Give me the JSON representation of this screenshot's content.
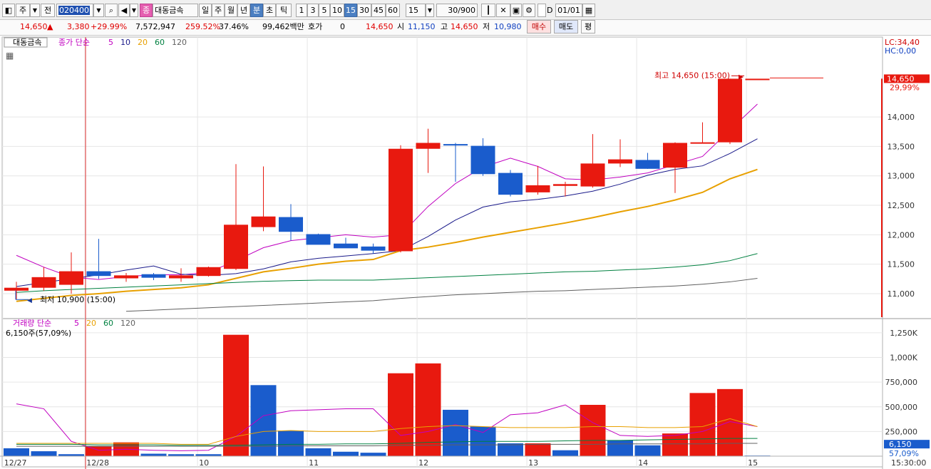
{
  "toolbar": {
    "period_mode": "주",
    "prev_label": "전",
    "code": "020400",
    "stock_name": "대동금속",
    "stock_badge": "종",
    "period_tabs": [
      {
        "label": "일",
        "selected": false
      },
      {
        "label": "주",
        "selected": false
      },
      {
        "label": "월",
        "selected": false
      },
      {
        "label": "년",
        "selected": false
      },
      {
        "label": "분",
        "selected": true
      },
      {
        "label": "초",
        "selected": false
      },
      {
        "label": "틱",
        "selected": false
      }
    ],
    "minute_tabs": [
      {
        "label": "1",
        "selected": false
      },
      {
        "label": "3",
        "selected": false
      },
      {
        "label": "5",
        "selected": false
      },
      {
        "label": "10",
        "selected": false
      },
      {
        "label": "15",
        "selected": true
      },
      {
        "label": "30",
        "selected": false
      },
      {
        "label": "45",
        "selected": false
      },
      {
        "label": "60",
        "selected": false
      }
    ],
    "interval_value": "15",
    "count_value": "30",
    "count_max": "/900",
    "d_label": "D",
    "date_value": "01/01"
  },
  "quote": {
    "price": "14,650",
    "change": "3,380",
    "change_pct": "+29.99%",
    "volume": "7,572,947",
    "vol_ratio": "259.52%",
    "turnover": "37.46%",
    "amount": "99,462백만",
    "hoga_label": "호가",
    "hoga_value": "0",
    "hoga_price": "14,650",
    "open_label": "시",
    "open_value": "11,150",
    "high_label": "고",
    "high_value": "14,650",
    "low_label": "저",
    "low_value": "10,980",
    "buy_label": "매수",
    "sell_label": "매도",
    "eval_label": "평"
  },
  "chart_data": {
    "type": "candlestick",
    "stock_label": "대동금속",
    "price_legend": {
      "prefix": "종가 단순",
      "ma_periods": [
        "5",
        "10",
        "20",
        "60",
        "120"
      ],
      "ma_colors": [
        "#c000c0",
        "#1a1a8a",
        "#e8a000",
        "#008040",
        "#606060"
      ]
    },
    "lc_label": "LC:34,40",
    "hc_label": "HC:0,00",
    "price_axis": {
      "min": 10600,
      "max": 15200,
      "ticks": [
        "14,000",
        "13,500",
        "13,000",
        "12,500",
        "12,000",
        "11,500",
        "11,000"
      ],
      "tick_values": [
        14000,
        13500,
        13000,
        12500,
        12000,
        11500,
        11000
      ]
    },
    "current_price_badge": "14,650",
    "current_pct_badge": "29,99%",
    "high_annotation": "최고 14,650 (15:00)",
    "low_annotation": "최저 10,900 (15:00)",
    "candles": [
      {
        "o": 11050,
        "h": 11200,
        "l": 10900,
        "c": 11100
      },
      {
        "o": 11100,
        "h": 11450,
        "l": 11050,
        "c": 11280
      },
      {
        "o": 11150,
        "h": 11700,
        "l": 11000,
        "c": 11380
      },
      {
        "o": 11380,
        "h": 11930,
        "l": 11250,
        "c": 11300
      },
      {
        "o": 11260,
        "h": 11350,
        "l": 11200,
        "c": 11310
      },
      {
        "o": 11330,
        "h": 11350,
        "l": 11230,
        "c": 11270
      },
      {
        "o": 11260,
        "h": 11430,
        "l": 11200,
        "c": 11310
      },
      {
        "o": 11300,
        "h": 11460,
        "l": 11290,
        "c": 11450
      },
      {
        "o": 11420,
        "h": 13200,
        "l": 11400,
        "c": 12170
      },
      {
        "o": 12130,
        "h": 13160,
        "l": 12060,
        "c": 12310
      },
      {
        "o": 12300,
        "h": 12520,
        "l": 11900,
        "c": 12050
      },
      {
        "o": 12010,
        "h": 12020,
        "l": 11840,
        "c": 11830
      },
      {
        "o": 11850,
        "h": 11950,
        "l": 11780,
        "c": 11770
      },
      {
        "o": 11800,
        "h": 11850,
        "l": 11680,
        "c": 11730
      },
      {
        "o": 11720,
        "h": 13520,
        "l": 11700,
        "c": 13460
      },
      {
        "o": 13460,
        "h": 13800,
        "l": 13050,
        "c": 13560
      },
      {
        "o": 13540,
        "h": 13560,
        "l": 12900,
        "c": 13530
      },
      {
        "o": 13510,
        "h": 13640,
        "l": 13000,
        "c": 13030
      },
      {
        "o": 13050,
        "h": 13100,
        "l": 12650,
        "c": 12680
      },
      {
        "o": 12720,
        "h": 13170,
        "l": 12680,
        "c": 12840
      },
      {
        "o": 12830,
        "h": 12900,
        "l": 12650,
        "c": 12860
      },
      {
        "o": 12820,
        "h": 13710,
        "l": 12800,
        "c": 13210
      },
      {
        "o": 13210,
        "h": 13620,
        "l": 13150,
        "c": 13280
      },
      {
        "o": 13270,
        "h": 13390,
        "l": 13120,
        "c": 13120
      },
      {
        "o": 13140,
        "h": 13570,
        "l": 12710,
        "c": 13560
      },
      {
        "o": 13560,
        "h": 13910,
        "l": 13550,
        "c": 13570
      },
      {
        "o": 13570,
        "h": 14650,
        "l": 13540,
        "c": 14650
      },
      {
        "o": 14650,
        "h": 14650,
        "l": 14650,
        "c": 14650
      }
    ],
    "ma": [
      {
        "name": "5",
        "color": "#c000c0",
        "values": [
          11650,
          11450,
          11280,
          11240,
          11290,
          11320,
          11320,
          11360,
          11560,
          11780,
          11900,
          11950,
          12000,
          11960,
          12000,
          12480,
          12870,
          13150,
          13300,
          13160,
          12950,
          12930,
          12980,
          13050,
          13190,
          13330,
          13780,
          14220
        ]
      },
      {
        "name": "10",
        "color": "#1a1a8a",
        "values": [
          11120,
          11190,
          11250,
          11320,
          11400,
          11470,
          11330,
          11310,
          11340,
          11420,
          11540,
          11600,
          11640,
          11680,
          11730,
          11970,
          12250,
          12470,
          12560,
          12600,
          12660,
          12740,
          12860,
          13010,
          13110,
          13170,
          13380,
          13630
        ]
      },
      {
        "name": "20",
        "color": "#e8a000",
        "values": [
          10870,
          10920,
          10970,
          11000,
          11040,
          11070,
          11100,
          11150,
          11260,
          11370,
          11430,
          11500,
          11550,
          11580,
          11730,
          11790,
          11870,
          11960,
          12040,
          12120,
          12200,
          12290,
          12390,
          12480,
          12590,
          12720,
          12950,
          13110
        ]
      },
      {
        "name": "60",
        "color": "#008040",
        "values": [
          11020,
          11050,
          11070,
          11090,
          11110,
          11130,
          11150,
          11170,
          11190,
          11210,
          11220,
          11230,
          11230,
          11230,
          11250,
          11270,
          11290,
          11310,
          11330,
          11350,
          11370,
          11380,
          11400,
          11420,
          11450,
          11490,
          11560,
          11680
        ]
      },
      {
        "name": "120",
        "color": "#606060",
        "values": [
          null,
          null,
          null,
          null,
          10700,
          10720,
          10740,
          10760,
          10780,
          10800,
          10820,
          10840,
          10860,
          10880,
          10920,
          10950,
          10980,
          11000,
          11020,
          11040,
          11050,
          11070,
          11090,
          11110,
          11130,
          11160,
          11200,
          11260
        ]
      }
    ],
    "volume_legend": {
      "prefix": "거래량 단순",
      "ma_periods": [
        "5",
        "20",
        "60",
        "120"
      ]
    },
    "volume_info": "6,150주(57,09%)",
    "volume_axis": {
      "min": 0,
      "max": 1250000,
      "ticks": [
        "1,250K",
        "1,000K",
        "750,000",
        "500,000",
        "250,000"
      ],
      "tick_values": [
        1250000,
        1000000,
        750000,
        500000,
        250000
      ]
    },
    "volume_badge": "6,150",
    "volume_pct_badge": "57,09%",
    "volumes": [
      {
        "v": 80000,
        "up": false
      },
      {
        "v": 50000,
        "up": false
      },
      {
        "v": 20000,
        "up": false
      },
      {
        "v": 100000,
        "up": true
      },
      {
        "v": 140000,
        "up": true
      },
      {
        "v": 25000,
        "up": false
      },
      {
        "v": 20000,
        "up": false
      },
      {
        "v": 20000,
        "up": false
      },
      {
        "v": 1230000,
        "up": true
      },
      {
        "v": 720000,
        "up": false
      },
      {
        "v": 260000,
        "up": false
      },
      {
        "v": 80000,
        "up": false
      },
      {
        "v": 45000,
        "up": false
      },
      {
        "v": 35000,
        "up": false
      },
      {
        "v": 840000,
        "up": true
      },
      {
        "v": 940000,
        "up": true
      },
      {
        "v": 470000,
        "up": false
      },
      {
        "v": 300000,
        "up": false
      },
      {
        "v": 130000,
        "up": false
      },
      {
        "v": 130000,
        "up": true
      },
      {
        "v": 60000,
        "up": false
      },
      {
        "v": 520000,
        "up": true
      },
      {
        "v": 160000,
        "up": false
      },
      {
        "v": 110000,
        "up": false
      },
      {
        "v": 230000,
        "up": true
      },
      {
        "v": 640000,
        "up": true
      },
      {
        "v": 680000,
        "up": true
      },
      {
        "v": 6150,
        "up": false
      }
    ],
    "vol_ma": [
      {
        "name": "5",
        "color": "#c000c0",
        "values": [
          530000,
          480000,
          150000,
          60000,
          70000,
          60000,
          55000,
          60000,
          200000,
          410000,
          460000,
          470000,
          480000,
          480000,
          210000,
          250000,
          320000,
          240000,
          420000,
          440000,
          520000,
          340000,
          210000,
          200000,
          210000,
          250000,
          350000,
          300000
        ]
      },
      {
        "name": "20",
        "color": "#e8a000",
        "values": [
          130000,
          130000,
          130000,
          130000,
          130000,
          130000,
          120000,
          120000,
          200000,
          250000,
          260000,
          250000,
          250000,
          250000,
          280000,
          300000,
          310000,
          300000,
          290000,
          290000,
          290000,
          300000,
          300000,
          290000,
          290000,
          300000,
          380000,
          300000
        ]
      },
      {
        "name": "60",
        "color": "#008040",
        "values": [
          120000,
          120000,
          120000,
          115000,
          115000,
          115000,
          110000,
          110000,
          110000,
          115000,
          120000,
          120000,
          125000,
          125000,
          130000,
          140000,
          145000,
          150000,
          150000,
          150000,
          155000,
          160000,
          160000,
          165000,
          170000,
          175000,
          180000,
          180000
        ]
      },
      {
        "name": "120",
        "color": "#606060",
        "values": [
          100000,
          100000,
          100000,
          100000,
          100000,
          100000,
          100000,
          100000,
          100000,
          100000,
          105000,
          105000,
          105000,
          105000,
          110000,
          110000,
          115000,
          115000,
          115000,
          120000,
          120000,
          120000,
          125000,
          125000,
          125000,
          125000,
          130000,
          130000
        ]
      }
    ],
    "x_labels": [
      {
        "label": "12/27",
        "idx": -0.5
      },
      {
        "label": "12/28",
        "idx": 2.5
      },
      {
        "label": "10",
        "idx": 6.6
      },
      {
        "label": "11",
        "idx": 10.6
      },
      {
        "label": "12",
        "idx": 14.6
      },
      {
        "label": "13",
        "idx": 18.6
      },
      {
        "label": "14",
        "idx": 22.6
      },
      {
        "label": "15",
        "idx": 26.6
      }
    ],
    "time_label": "15:30:00",
    "colors": {
      "up": "#e8190f",
      "down": "#1a5ccc",
      "grid": "#e6e6e6"
    }
  }
}
